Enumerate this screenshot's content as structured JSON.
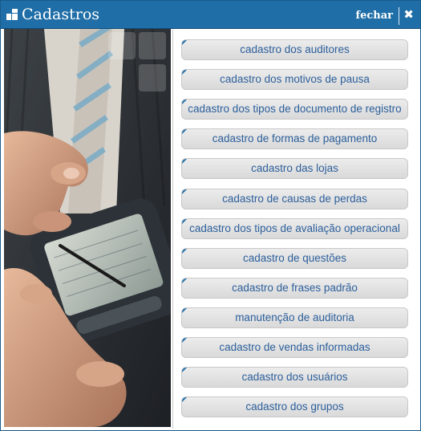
{
  "window": {
    "title": "Cadastros",
    "close_label": "fechar",
    "close_icon": "close-icon",
    "title_icon": "window-icon"
  },
  "photo": {
    "icon": "hand-holding-pda-photo"
  },
  "menu": {
    "items": [
      {
        "label": "cadastro dos auditores"
      },
      {
        "label": "cadastro dos motivos de pausa"
      },
      {
        "label": "cadastro dos tipos de documento de registro"
      },
      {
        "label": "cadastro de formas de pagamento"
      },
      {
        "label": "cadastro das lojas"
      },
      {
        "label": "cadastro de causas de perdas"
      },
      {
        "label": "cadastro dos tipos de avaliação operacional"
      },
      {
        "label": "cadastro de questões"
      },
      {
        "label": "cadastro de frases padrão"
      },
      {
        "label": "manutenção de auditoria"
      },
      {
        "label": "cadastro de vendas informadas"
      },
      {
        "label": "cadastro dos usuários"
      },
      {
        "label": "cadastro dos grupos"
      }
    ]
  },
  "colors": {
    "titlebar": "#1f6ea7",
    "item_text": "#2c5f9b",
    "item_bg": "#e3e3e3"
  }
}
